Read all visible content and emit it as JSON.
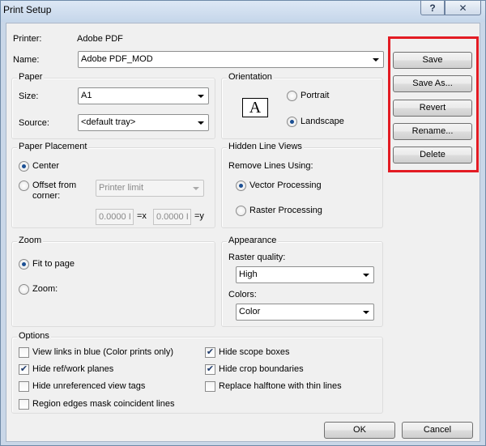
{
  "window": {
    "title": "Print Setup",
    "help_label": "?",
    "close_label": "✕"
  },
  "printer": {
    "label": "Printer:",
    "value": "Adobe PDF",
    "name_label": "Name:",
    "name_value": "Adobe PDF_MOD"
  },
  "paper": {
    "title": "Paper",
    "size_label": "Size:",
    "size_value": "A1",
    "source_label": "Source:",
    "source_value": "<default tray>"
  },
  "orientation": {
    "title": "Orientation",
    "icon_glyph": "A",
    "portrait_label": "Portrait",
    "landscape_label": "Landscape",
    "selected": "Landscape"
  },
  "paper_placement": {
    "title": "Paper Placement",
    "center_label": "Center",
    "offset_label_line1": "Offset from",
    "offset_label_line2": "corner:",
    "offset_dropdown": "Printer limit",
    "x_value": "0.0000 I",
    "x_suffix": "=x",
    "y_value": "0.0000 I",
    "y_suffix": "=y",
    "selected": "Center"
  },
  "hidden_line_views": {
    "title": "Hidden Line Views",
    "remove_label": "Remove Lines Using:",
    "vector_label": "Vector Processing",
    "raster_label": "Raster Processing",
    "selected": "Vector Processing"
  },
  "zoom": {
    "title": "Zoom",
    "fit_label": "Fit to page",
    "zoom_label": "Zoom:",
    "selected": "Fit to page"
  },
  "appearance": {
    "title": "Appearance",
    "raster_label": "Raster quality:",
    "raster_value": "High",
    "colors_label": "Colors:",
    "colors_value": "Color"
  },
  "options": {
    "title": "Options",
    "items": [
      {
        "label": "View links in blue (Color prints only)",
        "checked": false
      },
      {
        "label": "Hide ref/work planes",
        "checked": true
      },
      {
        "label": "Hide unreferenced view tags",
        "checked": false
      },
      {
        "label": "Region edges mask coincident lines",
        "checked": false
      },
      {
        "label": "Hide scope boxes",
        "checked": true
      },
      {
        "label": "Hide crop boundaries",
        "checked": true
      },
      {
        "label": "Replace halftone with thin lines",
        "checked": false
      }
    ]
  },
  "side_buttons": {
    "save": "Save",
    "save_as": "Save As...",
    "revert": "Revert",
    "rename": "Rename...",
    "delete": "Delete"
  },
  "footer": {
    "ok": "OK",
    "cancel": "Cancel"
  },
  "colors": {
    "highlight": "#e31b23",
    "radio_dot": "#1b4f93",
    "check_mark": "#1d3a6b"
  },
  "check_glyph": "✔"
}
